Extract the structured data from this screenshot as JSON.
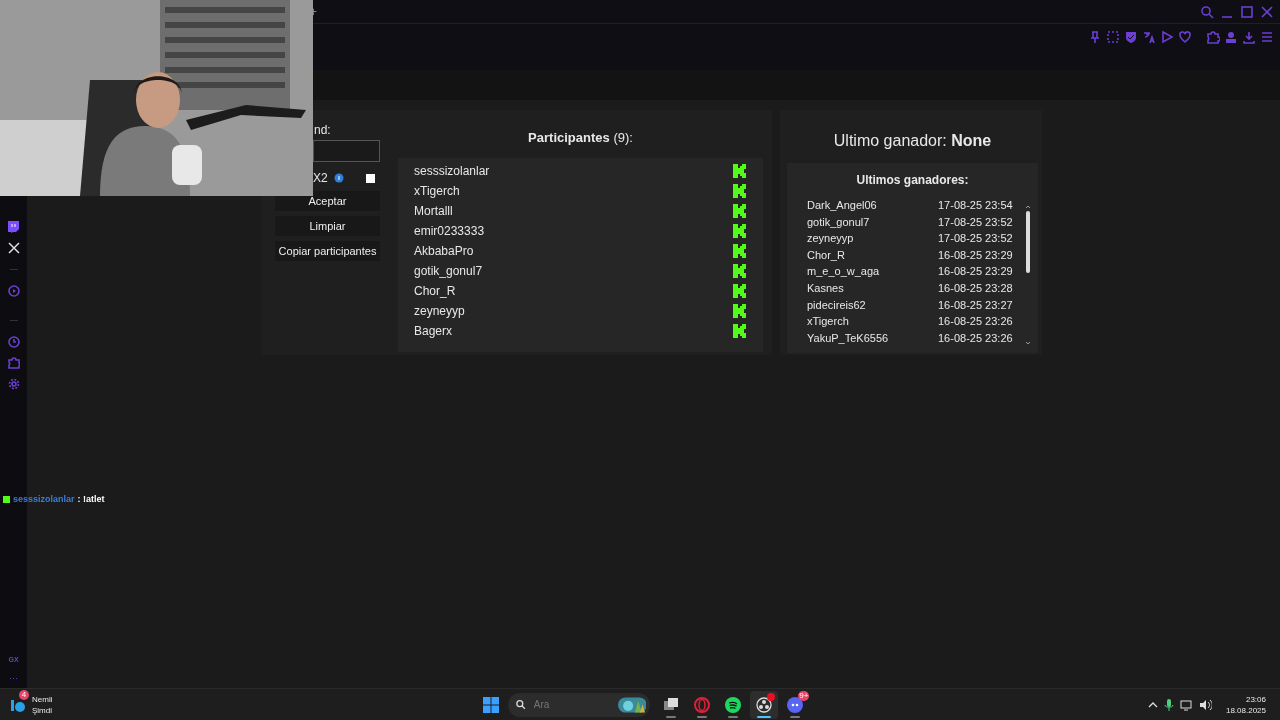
{
  "browser": {
    "new_tab": "+"
  },
  "sidebar": {
    "bottom_label": "GX",
    "more": "···"
  },
  "chat_message": {
    "user": "sesssizolanlar",
    "text": ": !atlet"
  },
  "controls": {
    "field_label": "nd:",
    "x2_label": "X2",
    "x2_checked": false,
    "buttons": [
      "Aceptar",
      "Limpiar",
      "Copiar participantes"
    ]
  },
  "participants": {
    "title": "Participantes",
    "count": "(9):",
    "items": [
      {
        "name": "sesssizolanlar"
      },
      {
        "name": "xTigerch"
      },
      {
        "name": "Mortalll"
      },
      {
        "name": "emir0233333"
      },
      {
        "name": "AkbabaPro"
      },
      {
        "name": "gotik_gonul7"
      },
      {
        "name": "Chor_R"
      },
      {
        "name": "zeyneyyp"
      },
      {
        "name": "Bagerx"
      }
    ]
  },
  "last_winner": {
    "label": "Ultimo ganador:",
    "value": "None"
  },
  "recent_winners": {
    "title": "Ultimos ganadores:",
    "rows": [
      {
        "name": "Dark_Angel06",
        "time": "17-08-25 23:54"
      },
      {
        "name": "gotik_gonul7",
        "time": "17-08-25 23:52"
      },
      {
        "name": "zeyneyyp",
        "time": "17-08-25 23:52"
      },
      {
        "name": "Chor_R",
        "time": "16-08-25 23:29"
      },
      {
        "name": "m_e_o_w_aga",
        "time": "16-08-25 23:29"
      },
      {
        "name": "Kasnes",
        "time": "16-08-25 23:28"
      },
      {
        "name": "pidecireis62",
        "time": "16-08-25 23:27"
      },
      {
        "name": "xTigerch",
        "time": "16-08-25 23:26"
      },
      {
        "name": "YakuP_TeK6556",
        "time": "16-08-25 23:26"
      }
    ]
  },
  "taskbar": {
    "weather": {
      "badge": "4",
      "title": "Nemli",
      "subtitle": "Şimdi"
    },
    "search_placeholder": "Ara",
    "apps": [
      {
        "kind": "taskview",
        "selected": false
      },
      {
        "kind": "opera",
        "selected": false
      },
      {
        "kind": "spotify",
        "selected": false
      },
      {
        "kind": "obs",
        "selected": true,
        "notification": true
      },
      {
        "kind": "discord",
        "selected": false,
        "badge": "9+"
      }
    ],
    "time": "23:06",
    "date": "18.08.2025"
  }
}
